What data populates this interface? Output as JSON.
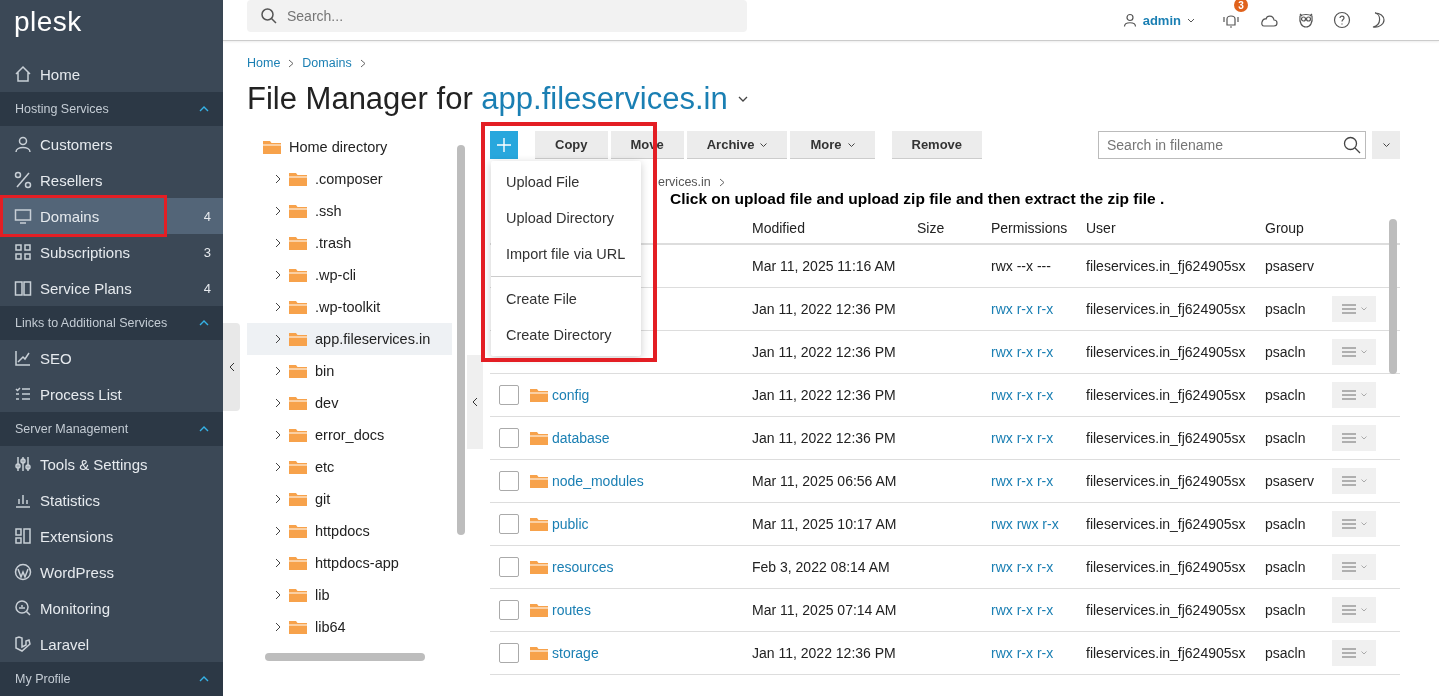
{
  "sidebar": {
    "logo": "plesk",
    "sections": [
      {
        "items": [
          {
            "label": "Home",
            "selected": false
          }
        ]
      },
      {
        "title": "Hosting Services",
        "expanded": true,
        "items": [
          {
            "label": "Customers",
            "selected": false
          },
          {
            "label": "Resellers",
            "selected": false
          },
          {
            "label": "Domains",
            "count": "4",
            "selected": true
          },
          {
            "label": "Subscriptions",
            "count": "3",
            "selected": false
          },
          {
            "label": "Service Plans",
            "count": "4",
            "selected": false
          }
        ]
      },
      {
        "title": "Links to Additional Services",
        "expanded": true,
        "items": [
          {
            "label": "SEO",
            "selected": false
          },
          {
            "label": "Process List",
            "selected": false
          }
        ]
      },
      {
        "title": "Server Management",
        "expanded": true,
        "items": [
          {
            "label": "Tools & Settings",
            "selected": false
          },
          {
            "label": "Statistics",
            "selected": false
          },
          {
            "label": "Extensions",
            "selected": false
          },
          {
            "label": "WordPress",
            "selected": false
          },
          {
            "label": "Monitoring",
            "selected": false
          },
          {
            "label": "Laravel",
            "selected": false
          }
        ]
      },
      {
        "title": "My Profile",
        "expanded": true
      }
    ]
  },
  "header": {
    "search": {
      "placeholder": "Search..."
    },
    "user": "admin",
    "notifications": "3"
  },
  "breadcrumb": [
    "Home",
    "Domains"
  ],
  "title": {
    "text": "File Manager for ",
    "domain": "app.fileservices.in"
  },
  "tree": {
    "root": "Home directory",
    "children": [
      {
        "label": ".composer",
        "selected": false
      },
      {
        "label": ".ssh",
        "selected": false
      },
      {
        "label": ".trash",
        "selected": false
      },
      {
        "label": ".wp-cli",
        "selected": false
      },
      {
        "label": ".wp-toolkit",
        "selected": false
      },
      {
        "label": "app.fileservices.in",
        "selected": true
      },
      {
        "label": "bin",
        "selected": false
      },
      {
        "label": "dev",
        "selected": false
      },
      {
        "label": "error_docs",
        "selected": false
      },
      {
        "label": "etc",
        "selected": false
      },
      {
        "label": "git",
        "selected": false
      },
      {
        "label": "httpdocs",
        "selected": false
      },
      {
        "label": "httpdocs-app",
        "selected": false
      },
      {
        "label": "lib",
        "selected": false
      },
      {
        "label": "lib64",
        "selected": false
      }
    ]
  },
  "toolbar": {
    "buttons": [
      {
        "label": "Copy",
        "dropdown": false
      },
      {
        "label": "Move",
        "dropdown": false
      },
      {
        "label": "Archive",
        "dropdown": true
      },
      {
        "label": "More",
        "dropdown": true
      },
      {
        "label": "Remove",
        "dropdown": false
      }
    ],
    "search": {
      "placeholder": "Search in filename"
    }
  },
  "new_menu": {
    "groups": [
      [
        "Upload File",
        "Upload Directory",
        "Import file via URL"
      ],
      [
        "Create File",
        "Create Directory"
      ]
    ]
  },
  "path": "ervices.in",
  "annotation": "Click on upload file and upload zip file and then extract the zip file .",
  "table": {
    "columns": [
      "Modified",
      "Size",
      "Permissions",
      "User",
      "Group"
    ],
    "rows": [
      {
        "kind": "parent",
        "modified": "Mar 11, 2025 11:16 AM",
        "permissions": "rwx --x ---",
        "user": "fileservices.in_fj624905sx",
        "group": "psaserv"
      },
      {
        "kind": "folder",
        "modified": "Jan 11, 2022 12:36 PM",
        "permissions": "rwx r-x r-x",
        "user": "fileservices.in_fj624905sx",
        "group": "psacln"
      },
      {
        "kind": "folder",
        "modified": "Jan 11, 2022 12:36 PM",
        "permissions": "rwx r-x r-x",
        "user": "fileservices.in_fj624905sx",
        "group": "psacln"
      },
      {
        "kind": "folder",
        "name": "config",
        "checked": false,
        "modified": "Jan 11, 2022 12:36 PM",
        "permissions": "rwx r-x r-x",
        "user": "fileservices.in_fj624905sx",
        "group": "psacln"
      },
      {
        "kind": "folder",
        "name": "database",
        "checked": false,
        "modified": "Jan 11, 2022 12:36 PM",
        "permissions": "rwx r-x r-x",
        "user": "fileservices.in_fj624905sx",
        "group": "psacln"
      },
      {
        "kind": "folder",
        "name": "node_modules",
        "checked": false,
        "modified": "Mar 11, 2025 06:56 AM",
        "permissions": "rwx r-x r-x",
        "user": "fileservices.in_fj624905sx",
        "group": "psaserv"
      },
      {
        "kind": "folder",
        "name": "public",
        "checked": false,
        "modified": "Mar 11, 2025 10:17 AM",
        "permissions": "rwx rwx r-x",
        "user": "fileservices.in_fj624905sx",
        "group": "psacln"
      },
      {
        "kind": "folder",
        "name": "resources",
        "checked": false,
        "modified": "Feb 3, 2022 08:14 AM",
        "permissions": "rwx r-x r-x",
        "user": "fileservices.in_fj624905sx",
        "group": "psacln"
      },
      {
        "kind": "folder",
        "name": "routes",
        "checked": false,
        "modified": "Mar 11, 2025 07:14 AM",
        "permissions": "rwx r-x r-x",
        "user": "fileservices.in_fj624905sx",
        "group": "psacln"
      },
      {
        "kind": "folder",
        "name": "storage",
        "checked": false,
        "modified": "Jan 11, 2022 12:36 PM",
        "permissions": "rwx r-x r-x",
        "user": "fileservices.in_fj624905sx",
        "group": "psacln"
      }
    ]
  }
}
